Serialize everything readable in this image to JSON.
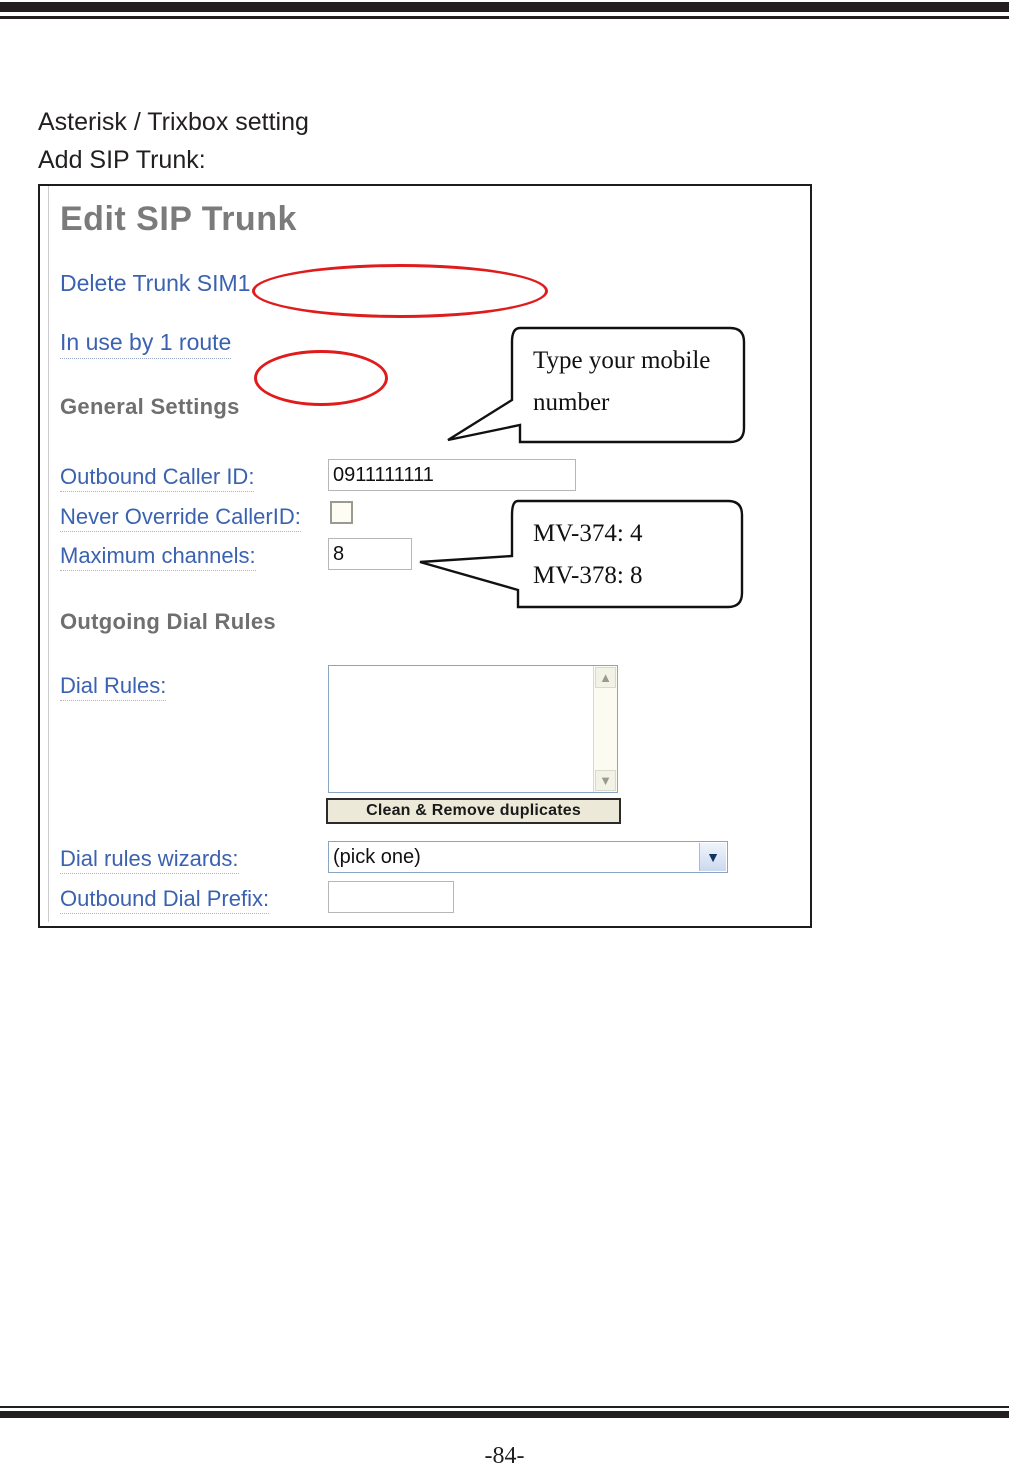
{
  "document": {
    "heading": "Asterisk / Trixbox setting",
    "subheading": "Add SIP Trunk:",
    "page_number": "-84-"
  },
  "screenshot": {
    "title": "Edit SIP Trunk",
    "links": [
      {
        "name": "delete-trunk",
        "label": "Delete Trunk SIM1"
      },
      {
        "name": "in-use-by-route",
        "label": "In use by 1 route"
      }
    ],
    "sections": {
      "general": {
        "heading": "General Settings",
        "fields": {
          "outbound_caller_id": {
            "label": "Outbound Caller ID:",
            "value": "0911111111"
          },
          "never_override_callerid": {
            "label": "Never Override CallerID:",
            "checked": false
          },
          "maximum_channels": {
            "label": "Maximum channels:",
            "value": "8"
          }
        }
      },
      "outgoing": {
        "heading": "Outgoing Dial Rules",
        "fields": {
          "dial_rules": {
            "label": "Dial Rules:",
            "value": ""
          },
          "clean_button": {
            "label": "Clean & Remove duplicates"
          },
          "dial_rules_wizards": {
            "label": "Dial rules wizards:",
            "selected": "(pick one)"
          },
          "outbound_dial_prefix": {
            "label": "Outbound Dial Prefix:",
            "value": "",
            "placeholder": ""
          }
        }
      }
    },
    "scrollbar": {
      "up_arrow": "scroll-up-icon",
      "down_arrow": "scroll-down-icon"
    },
    "dropdown_icon": "chevron-down-icon"
  },
  "annotations": {
    "callout_1": {
      "line1": "Type your mobile",
      "line2": "number",
      "target": "outbound-caller-id-field"
    },
    "callout_2": {
      "line1": "MV-374: 4",
      "line2": "MV-378: 8",
      "target": "maximum-channels-field"
    },
    "highlight_color": "#e01b1b"
  }
}
